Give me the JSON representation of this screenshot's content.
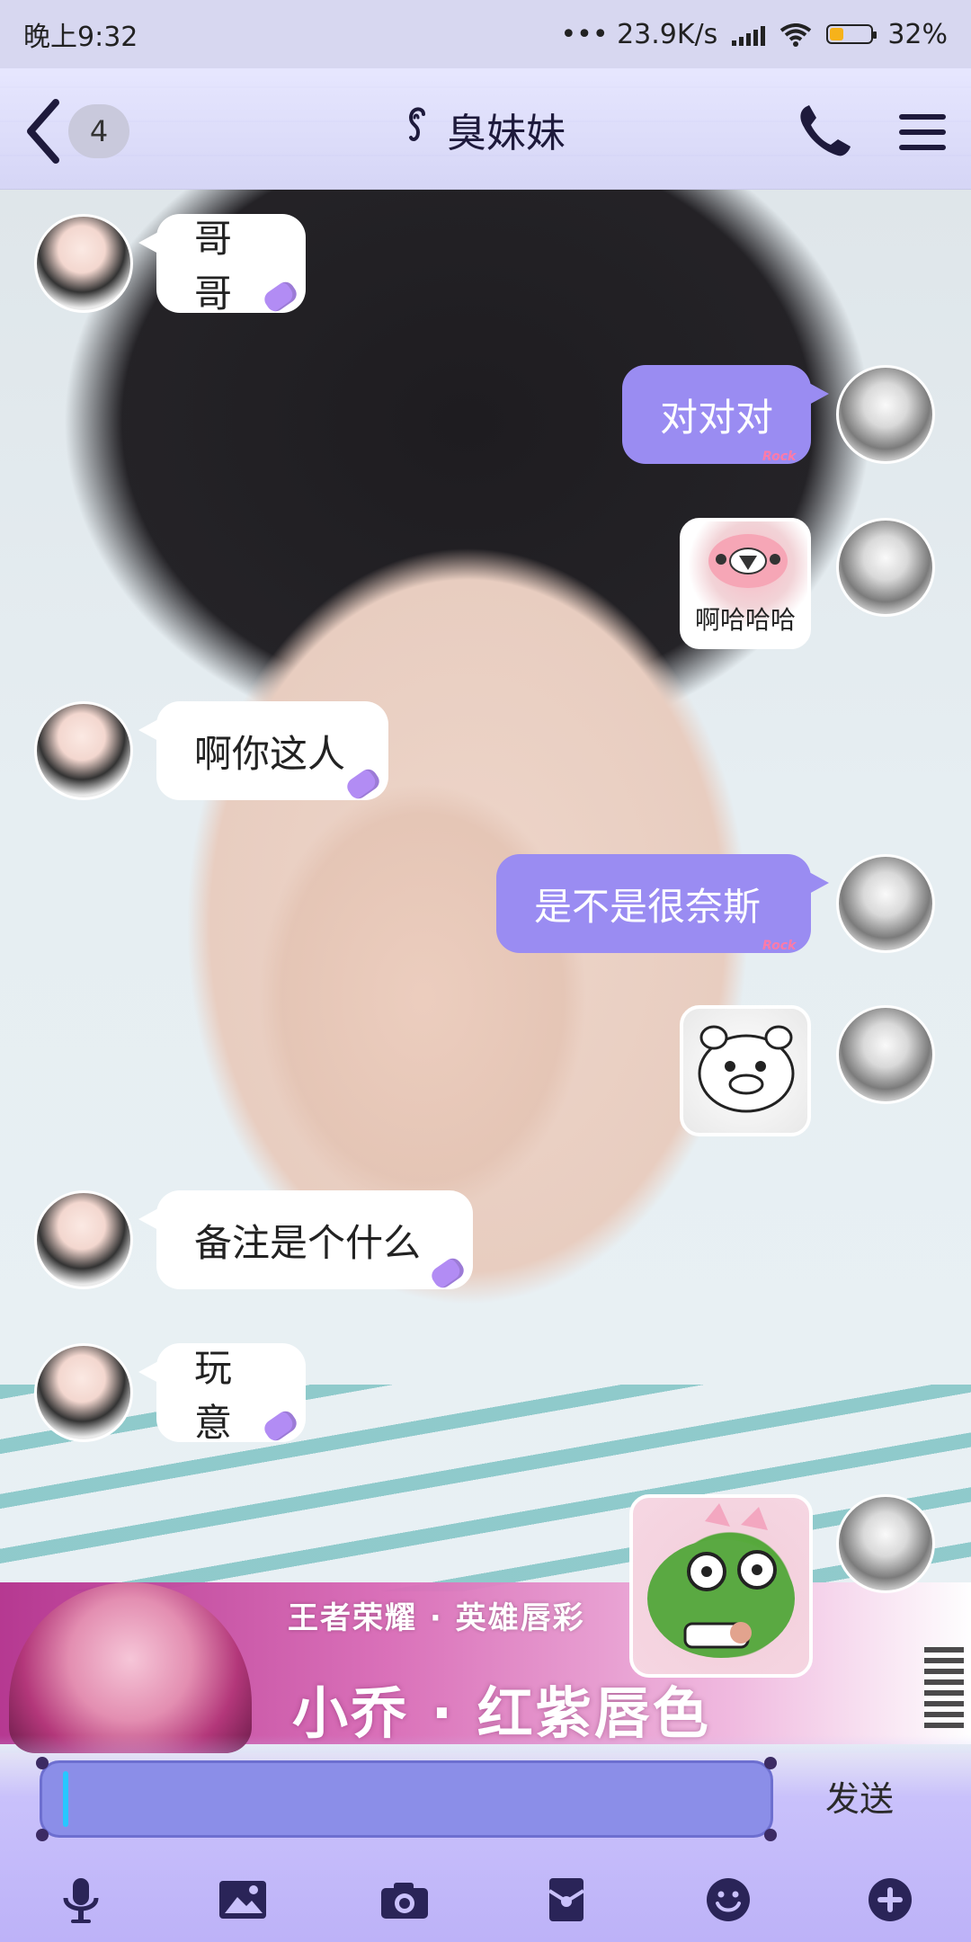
{
  "status_bar": {
    "time": "晚上9:32",
    "net_speed": "••• 23.9K/s",
    "battery": "32%"
  },
  "header": {
    "unread_count": "4",
    "contact_name": "臭妹妹",
    "icons": [
      "back-icon",
      "ear-icon",
      "phone-icon",
      "menu-icon"
    ]
  },
  "messages": [
    {
      "side": "in",
      "type": "text",
      "text": "哥哥"
    },
    {
      "side": "out",
      "type": "text",
      "text": "对对对",
      "tag": "Rock"
    },
    {
      "side": "out",
      "type": "sticker",
      "caption": "啊哈哈哈"
    },
    {
      "side": "in",
      "type": "text",
      "text": "啊你这人"
    },
    {
      "side": "out",
      "type": "text",
      "text": "是不是很奈斯",
      "tag": "Rock"
    },
    {
      "side": "out",
      "type": "sticker",
      "caption": ""
    },
    {
      "side": "in",
      "type": "text",
      "text": "备注是个什么"
    },
    {
      "side": "in",
      "type": "text",
      "text": "玩意"
    },
    {
      "side": "out",
      "type": "sticker",
      "caption": ""
    }
  ],
  "background_banner": {
    "top_text": "王者荣耀 · 英雄唇彩",
    "big_text": "小乔 · 红紫唇色"
  },
  "input": {
    "value": "",
    "send_label": "发送"
  },
  "toolbar": {
    "icons": [
      "mic-icon",
      "image-icon",
      "camera-icon",
      "red-packet-icon",
      "emoji-icon",
      "plus-icon"
    ]
  },
  "colors": {
    "accent_bubble": "#9a8cf2",
    "header_bg": "#d7d7f0",
    "input_bg": "#8b8ee8",
    "toolbar_icon": "#2a2458"
  }
}
